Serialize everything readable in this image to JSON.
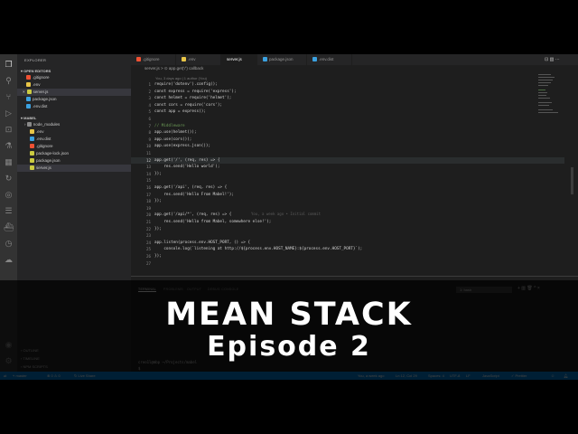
{
  "explorer": {
    "title": "EXPLORER",
    "open_editors_label": "OPEN EDITORS",
    "open_editors": [
      {
        "name": ".gitignore",
        "color": "#f05133"
      },
      {
        "name": ".env",
        "color": "#e8c547"
      },
      {
        "name": "server.js",
        "color": "#cbcb41",
        "modified_marker": "×"
      },
      {
        "name": "package.json",
        "color": "#3ba1e0"
      },
      {
        "name": ".env.dist",
        "color": "#3ba1e0"
      }
    ],
    "project_label": "MABEL",
    "project_files": [
      {
        "name": "node_modules",
        "color": "#8a8a8a"
      },
      {
        "name": ".env",
        "color": "#e8c547"
      },
      {
        "name": ".env.dist",
        "color": "#3ba1e0"
      },
      {
        "name": ".gitignore",
        "color": "#f05133"
      },
      {
        "name": "package-lock.json",
        "color": "#cbcb41"
      },
      {
        "name": "package.json",
        "color": "#cbcb41"
      },
      {
        "name": "server.js",
        "color": "#cbcb41"
      }
    ],
    "footer": [
      "OUTLINE",
      "TIMELINE",
      "NPM SCRIPTS"
    ]
  },
  "tabs": [
    {
      "label": ".gitignore",
      "active": false
    },
    {
      "label": ".env",
      "active": false
    },
    {
      "label": "server.js",
      "active": true
    },
    {
      "label": "package.json",
      "active": false
    },
    {
      "label": ".env.dist",
      "active": false
    }
  ],
  "breadcrumb": "server.js > ⊙ app.get('/') callback",
  "blame_header": "You, 3 days ago | 1 author (You)",
  "line_numbers": [
    "1",
    "2",
    "3",
    "4",
    "5",
    "6",
    "7",
    "8",
    "9",
    "10",
    "11",
    "12",
    "13",
    "14",
    "15",
    "16",
    "17",
    "18",
    "19",
    "20",
    "21",
    "22",
    "23",
    "24",
    "25",
    "26",
    "27"
  ],
  "code_lines": [
    "require('dotenv').config();",
    "const express = require('express');",
    "const helmet = require('helmet');",
    "const cors = require('cors');",
    "const app = express();",
    "",
    "// Middleware",
    "app.use(helmet());",
    "app.use(cors());",
    "app.use(express.json());",
    "",
    "app.get('/', (req, res) => {",
    "    res.send('Hello world');",
    "});",
    "",
    "app.get('/api', (req, res) => {",
    "    res.send('Hello From Mabel!');",
    "});",
    "",
    "app.get('/api/*', (req, res) => {",
    "    res.send('Hello from Mabel, somewhere else!');",
    "});",
    "",
    "app.listen(process.env.HOST_PORT, () => {",
    "    console.log(`listening at http://${process.env.HOST_NAME}:${process.env.HOST_PORT}`);",
    "});",
    ""
  ],
  "inline_blame": "You, a week ago • Initial commit",
  "panel": {
    "tabs": [
      "TERMINAL",
      "PROBLEMS",
      "OUTPUT",
      "DEBUG CONSOLE"
    ],
    "shell": "1: bash",
    "terminal_lines": [
      "creo1l@mbp ~/Projects/mabel",
      "$"
    ]
  },
  "statusbar": {
    "left": [
      "master",
      "⊗ 0 ⚠ 0",
      "Live Share"
    ],
    "right": [
      "You, a week ago",
      "Ln 12, Col 29",
      "Spaces: 4",
      "UTF-8",
      "LF",
      "JavaScript",
      "Prettier"
    ]
  },
  "overlay": {
    "title": "MEAN STACK",
    "subtitle": "Episode 2"
  }
}
